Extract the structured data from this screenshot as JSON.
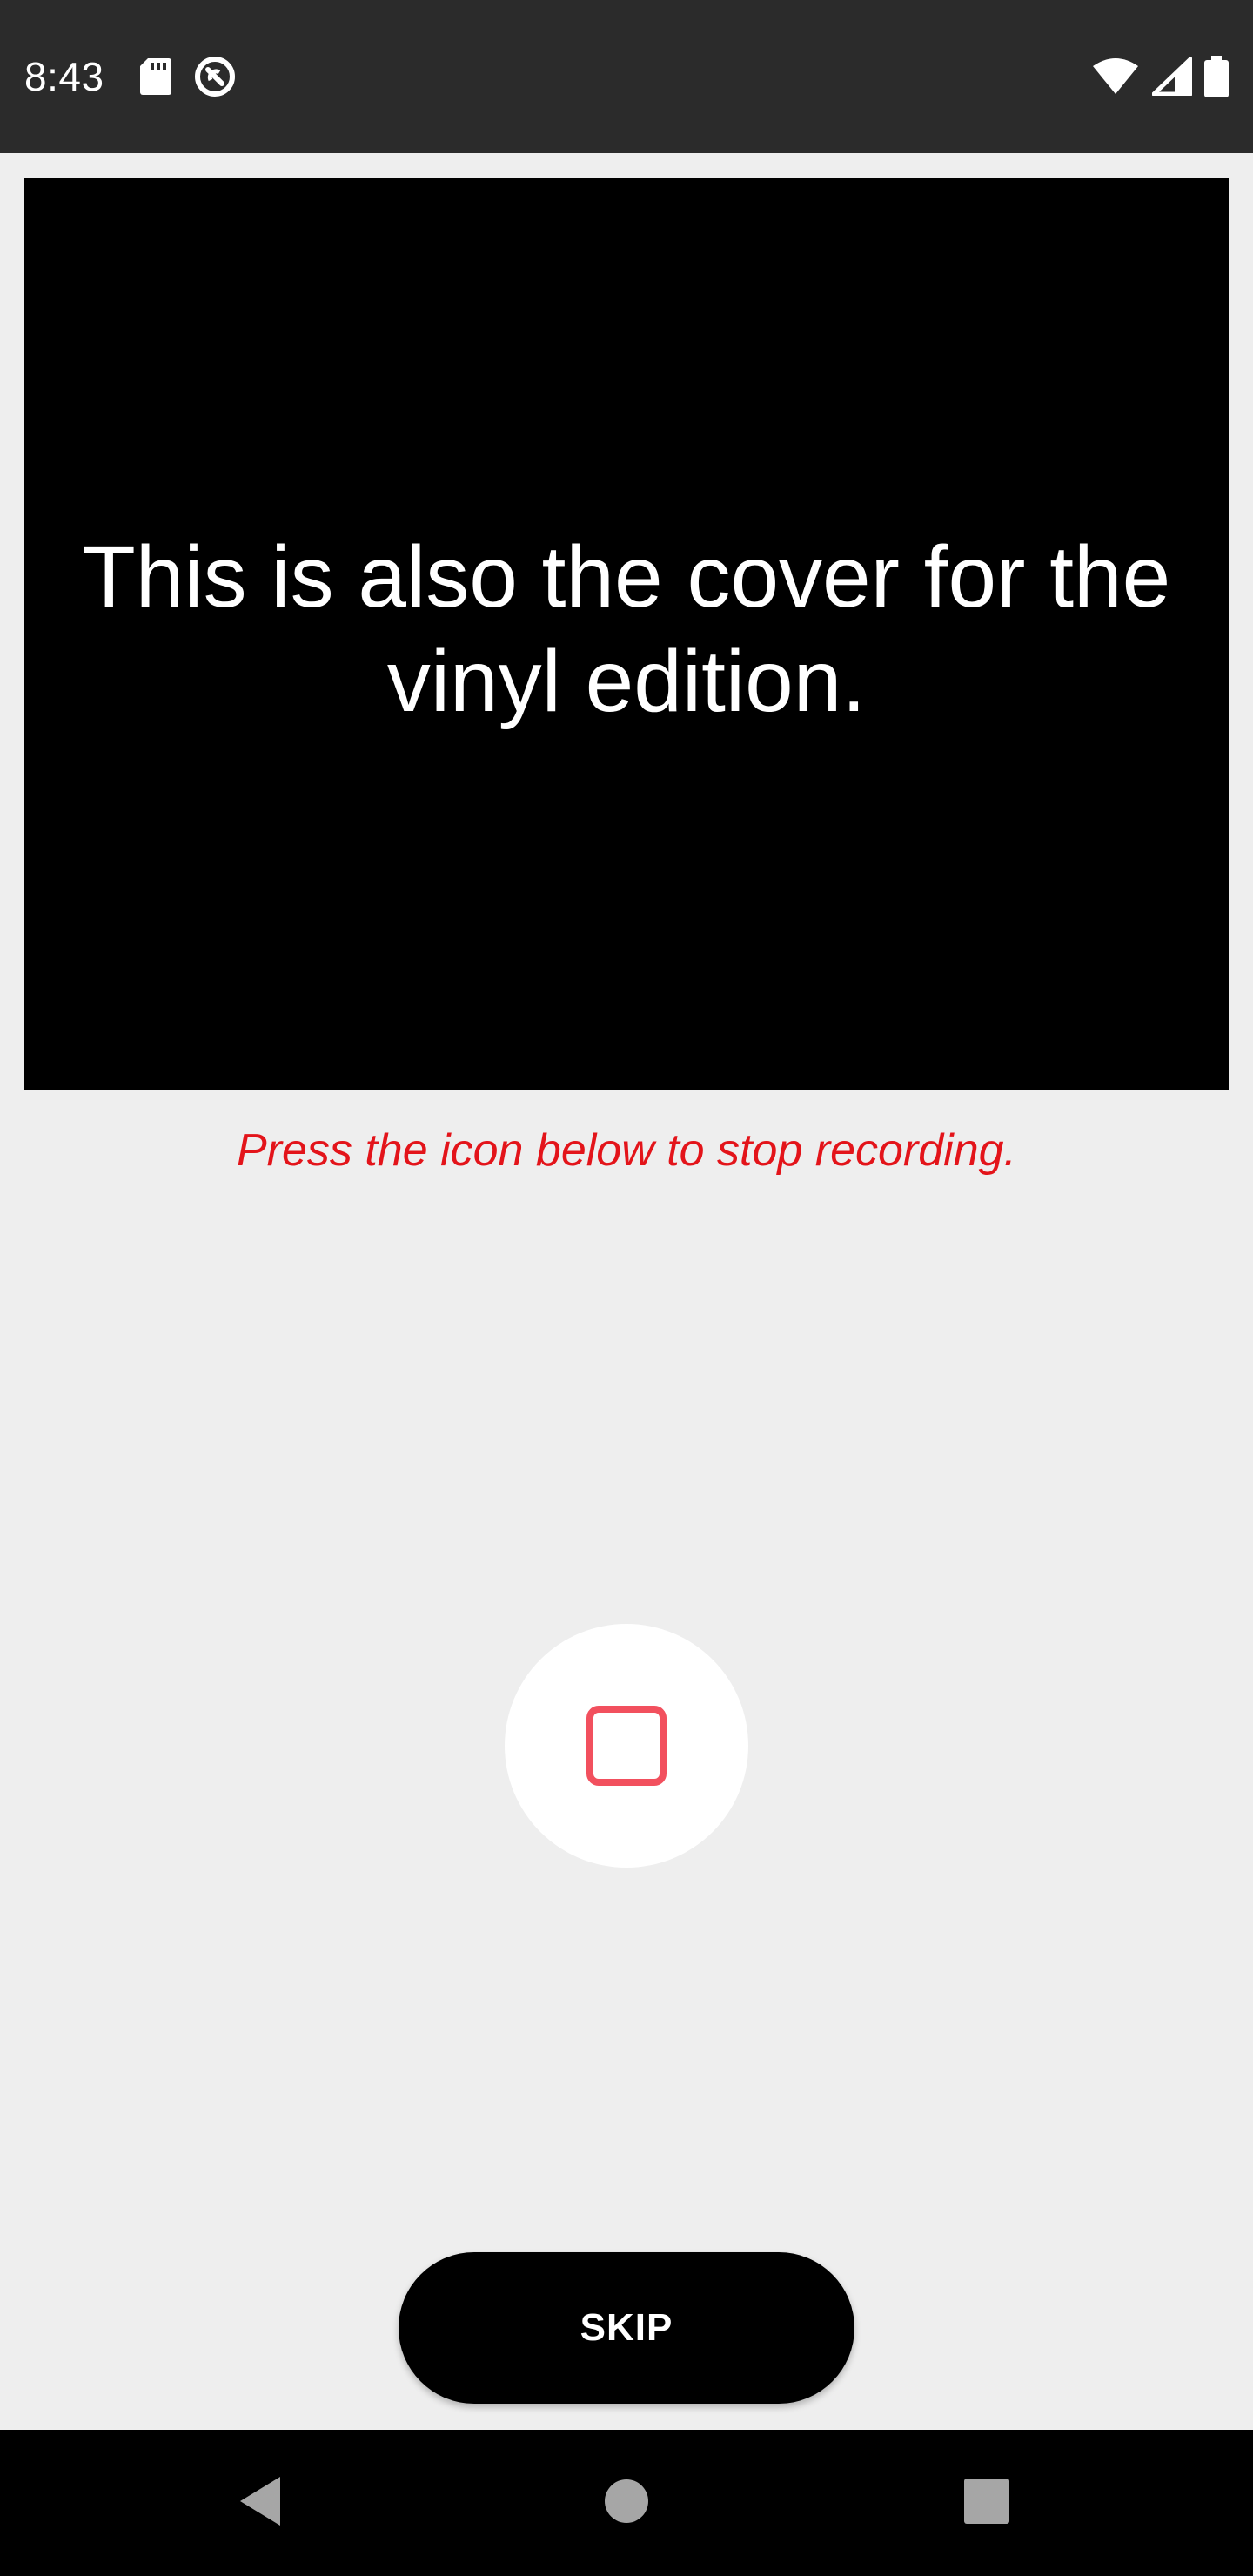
{
  "status_bar": {
    "time": "8:43",
    "left_icons": [
      "sd-card-icon",
      "do-not-disturb-icon"
    ],
    "right_icons": [
      "wifi-icon",
      "cell-signal-icon",
      "battery-icon"
    ]
  },
  "prompt": {
    "text": "This is also the cover for the vinyl edition."
  },
  "instruction": {
    "text": "Press the icon below to stop recording.",
    "color": "#e3141a"
  },
  "stop_button": {
    "icon": "stop-icon",
    "accent_color": "#f2505e"
  },
  "skip_button": {
    "label": "SKIP"
  },
  "nav_bar": {
    "buttons": [
      "back-icon",
      "home-icon",
      "recents-icon"
    ]
  }
}
